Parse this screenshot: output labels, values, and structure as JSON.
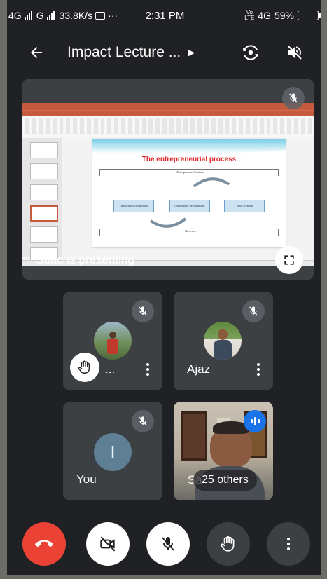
{
  "status_bar": {
    "network_1": "4G",
    "network_2": "G",
    "speed": "33.8K/s",
    "overflow": "···",
    "time": "2:31 PM",
    "volte": "Vo LTE",
    "network_3": "4G",
    "battery": "59%",
    "battery_level": 0.59,
    "battery_color": "#f4b400"
  },
  "header": {
    "title": "Impact Lecture ...",
    "back_icon": "arrow-left-icon",
    "switch_camera_icon": "switch-camera-icon",
    "speaker_icon": "speaker-off-icon"
  },
  "presentation": {
    "presenter_text": "Saad is presenting",
    "slide": {
      "title": "The entrepreneurial process",
      "top_label": "Entrepreneur Startups",
      "boxes": [
        "Opportunity recognition",
        "Opportunity development",
        "Value creation"
      ],
      "bottom_label": "Network"
    },
    "fullscreen_icon": "fullscreen-icon"
  },
  "participants": [
    {
      "name": "...",
      "muted": true,
      "hand_raised": true
    },
    {
      "name": "Ajaz",
      "muted": true,
      "hand_raised": false
    },
    {
      "name": "You",
      "initial": "I",
      "muted": true,
      "hand_raised": false
    },
    {
      "name": "Sa",
      "others_label": "25 others",
      "speaking": true
    }
  ],
  "controls": {
    "end_call": "end-call-icon",
    "camera": "camera-off-icon",
    "mic": "mic-off-icon",
    "raise_hand": "hand-icon",
    "more": "more-vert-icon"
  },
  "colors": {
    "background": "#202124",
    "tile": "#3c4043",
    "end_call": "#ea4335",
    "speaking": "#1a73e8"
  }
}
